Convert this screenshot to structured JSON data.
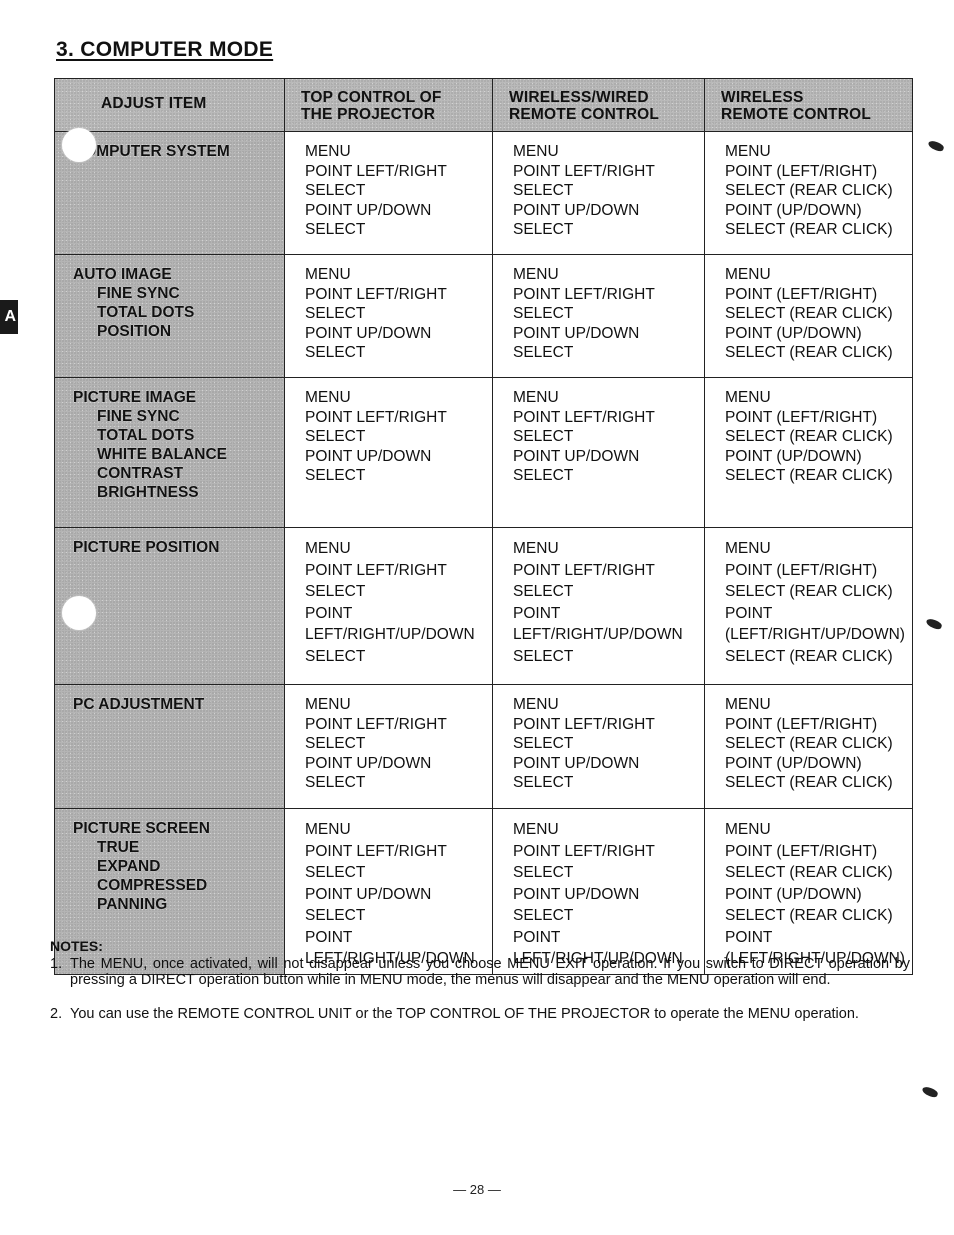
{
  "page": {
    "title": "3. COMPUTER MODE",
    "side_tab_label": "A",
    "page_number": "— 28 —"
  },
  "table": {
    "headers": [
      [
        "ADJUST ITEM"
      ],
      [
        "TOP CONTROL OF",
        "THE PROJECTOR"
      ],
      [
        "WIRELESS/WIRED",
        "REMOTE CONTROL"
      ],
      [
        "WIRELESS",
        "REMOTE CONTROL"
      ]
    ],
    "rows": [
      {
        "item": "COMPUTER SYSTEM",
        "subitems": [],
        "top_control": [
          "MENU",
          "POINT LEFT/RIGHT",
          "SELECT",
          "POINT UP/DOWN",
          "SELECT"
        ],
        "wireless_wired": [
          "MENU",
          "POINT LEFT/RIGHT",
          "SELECT",
          "POINT UP/DOWN",
          "SELECT"
        ],
        "wireless": [
          "MENU",
          "POINT (LEFT/RIGHT)",
          "SELECT (REAR CLICK)",
          "POINT (UP/DOWN)",
          "SELECT (REAR CLICK)"
        ]
      },
      {
        "item": "AUTO IMAGE",
        "subitems": [
          "FINE SYNC",
          "TOTAL DOTS",
          "POSITION"
        ],
        "top_control": [
          "MENU",
          "POINT LEFT/RIGHT",
          "SELECT",
          "POINT UP/DOWN",
          "SELECT"
        ],
        "wireless_wired": [
          "MENU",
          "POINT LEFT/RIGHT",
          "SELECT",
          "POINT UP/DOWN",
          "SELECT"
        ],
        "wireless": [
          "MENU",
          "POINT (LEFT/RIGHT)",
          "SELECT (REAR CLICK)",
          "POINT (UP/DOWN)",
          "SELECT (REAR CLICK)"
        ]
      },
      {
        "item": "PICTURE IMAGE",
        "subitems": [
          "FINE SYNC",
          "TOTAL DOTS",
          "WHITE BALANCE",
          "CONTRAST",
          "BRIGHTNESS"
        ],
        "top_control": [
          "MENU",
          "POINT LEFT/RIGHT",
          "SELECT",
          "POINT UP/DOWN",
          "SELECT"
        ],
        "wireless_wired": [
          "MENU",
          "POINT LEFT/RIGHT",
          "SELECT",
          "POINT UP/DOWN",
          "SELECT"
        ],
        "wireless": [
          "MENU",
          "POINT (LEFT/RIGHT)",
          "SELECT (REAR CLICK)",
          "POINT (UP/DOWN)",
          "SELECT (REAR CLICK)"
        ]
      },
      {
        "item": "PICTURE POSITION",
        "subitems": [],
        "top_control": [
          "MENU",
          "POINT LEFT/RIGHT",
          "SELECT",
          "POINT",
          "LEFT/RIGHT/UP/DOWN",
          "SELECT"
        ],
        "wireless_wired": [
          "MENU",
          "POINT LEFT/RIGHT",
          "SELECT",
          "POINT",
          "LEFT/RIGHT/UP/DOWN",
          "SELECT"
        ],
        "wireless": [
          "MENU",
          "POINT (LEFT/RIGHT)",
          "SELECT (REAR CLICK)",
          "POINT",
          "(LEFT/RIGHT/UP/DOWN)",
          "SELECT (REAR CLICK)"
        ]
      },
      {
        "item": "PC ADJUSTMENT",
        "subitems": [],
        "top_control": [
          "MENU",
          "POINT LEFT/RIGHT",
          "SELECT",
          "POINT UP/DOWN",
          "SELECT"
        ],
        "wireless_wired": [
          "MENU",
          "POINT LEFT/RIGHT",
          "SELECT",
          "POINT UP/DOWN",
          "SELECT"
        ],
        "wireless": [
          "MENU",
          "POINT (LEFT/RIGHT)",
          "SELECT (REAR CLICK)",
          "POINT (UP/DOWN)",
          "SELECT (REAR CLICK)"
        ]
      },
      {
        "item": "PICTURE SCREEN",
        "subitems": [
          "TRUE",
          "EXPAND",
          "COMPRESSED",
          "PANNING"
        ],
        "top_control": [
          "MENU",
          "POINT LEFT/RIGHT",
          "SELECT",
          "POINT UP/DOWN",
          "SELECT",
          "POINT",
          "LEFT/RIGHT/UP/DOWN"
        ],
        "wireless_wired": [
          "MENU",
          "POINT LEFT/RIGHT",
          "SELECT",
          "POINT UP/DOWN",
          "SELECT",
          "POINT",
          "LEFT/RIGHT/UP/DOWN"
        ],
        "wireless": [
          "MENU",
          "POINT (LEFT/RIGHT)",
          "SELECT (REAR CLICK)",
          "POINT (UP/DOWN)",
          "SELECT (REAR CLICK)",
          "POINT",
          "(LEFT/RIGHT/UP/DOWN)"
        ]
      }
    ]
  },
  "notes": {
    "heading": "NOTES:",
    "items": [
      {
        "number": "1.",
        "text": "The MENU, once activated, will not disappear unless you choose MENU EXIT operation. If you switch to DIRECT operation by pressing a DIRECT operation button while in MENU mode, the menus will disappear and the MENU operation will end."
      },
      {
        "number": "2.",
        "text": "You can use the REMOTE CONTROL UNIT or the TOP CONTROL OF THE PROJECTOR to operate the MENU operation."
      }
    ]
  }
}
